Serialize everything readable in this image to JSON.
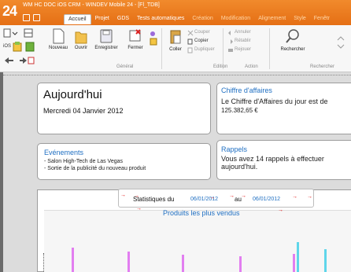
{
  "titlebar": {
    "logo": "24",
    "title": "WM HC DOC iOS CRM - WINDEV Mobile 24 - [Fl_TDB]"
  },
  "tabs": [
    {
      "label": "Accueil",
      "active": true
    },
    {
      "label": "Projet"
    },
    {
      "label": "GDS"
    },
    {
      "label": "Tests automatiques"
    },
    {
      "label": "Création"
    },
    {
      "label": "Modification"
    },
    {
      "label": "Alignement"
    },
    {
      "label": "Style"
    },
    {
      "label": "Fenêtr"
    }
  ],
  "ribbon": {
    "new_label": "Nouveau",
    "open_label": "Ouvrir",
    "save_label": "Enregistrer",
    "close_label": "Fermer",
    "paste_label": "Coller",
    "cut_label": "Couper",
    "copy_label": "Copier",
    "duplicate_label": "Dupliquer",
    "undo_label": "Annuler",
    "redo_label": "Rétablir",
    "replay_label": "Rejouer",
    "search_label": "Rechercher",
    "platform_label": "iOS",
    "groups": {
      "general": "Général",
      "edition": "Edition",
      "action": "Action",
      "search": "Rechercher"
    }
  },
  "today": {
    "title": "Aujourd'hui",
    "date": "Mercredi 04 Janvier 2012"
  },
  "events": {
    "title": "Evénements",
    "items": [
      "- Salon High-Tech de Las Vegas",
      "- Sortie de la publicité du nouveau produit"
    ]
  },
  "revenue": {
    "title": "Chiffre d'affaires",
    "text": "Le Chiffre d'Affaires du jour est de",
    "amount": "125.382,65 €"
  },
  "reminders": {
    "title": "Rappels",
    "line1": "Vous avez 14 rappels à effectuer",
    "line2": "aujourd'hui."
  },
  "stats": {
    "label_from": "Statistiques du",
    "date_from": "06/01/2012",
    "label_to": "au",
    "date_to": "06/01/2012"
  },
  "chart": {
    "title": "Produits les plus vendus"
  },
  "colors": {
    "accent_orange": "#e56f15",
    "blue": "#1f6fc2",
    "arrow_red": "#e00000",
    "bar_magenta": "#e27ef0",
    "bar_cyan": "#5fd6ea"
  }
}
